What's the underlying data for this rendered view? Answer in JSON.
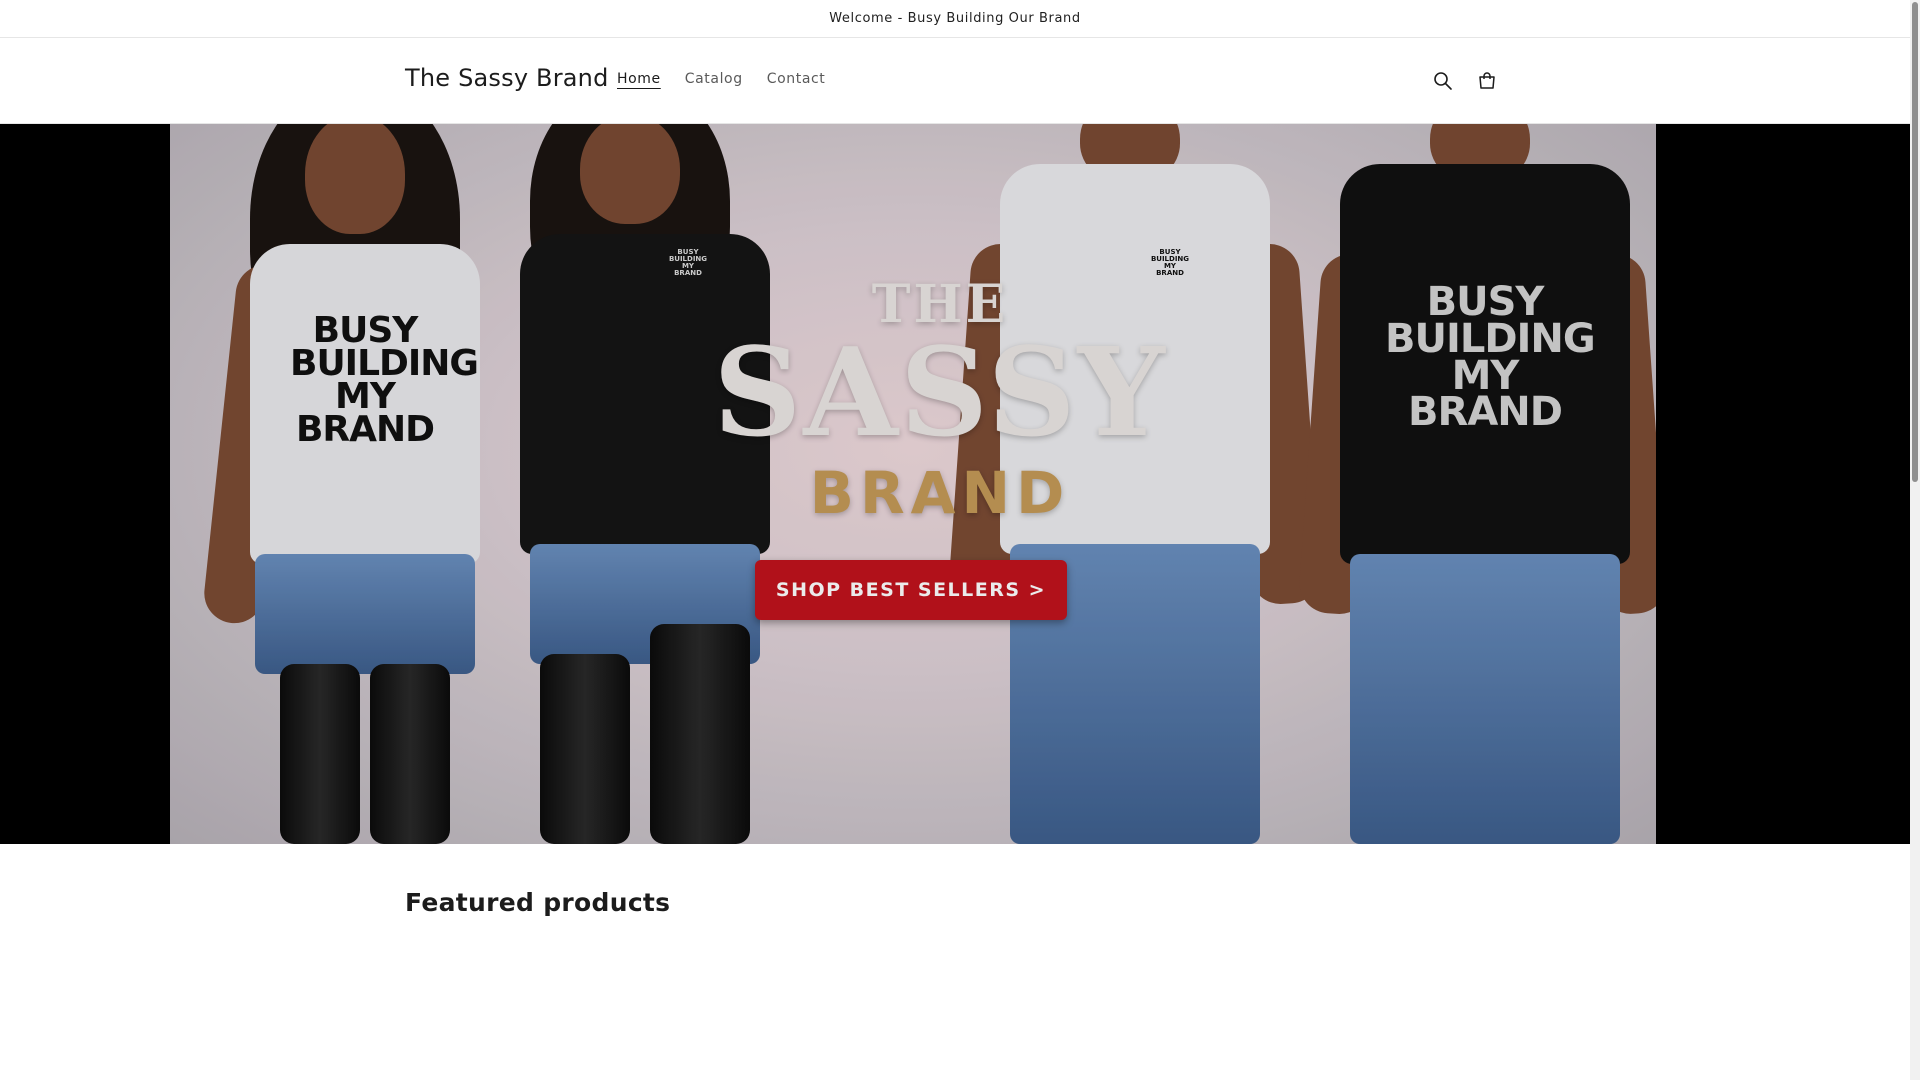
{
  "announcement": {
    "text": "Welcome - Busy Building Our Brand"
  },
  "header": {
    "brand": "The Sassy Brand",
    "nav": [
      {
        "label": "Home",
        "active": true
      },
      {
        "label": "Catalog",
        "active": false
      },
      {
        "label": "Contact",
        "active": false
      }
    ],
    "icons": {
      "search": "search-icon",
      "cart": "cart-icon"
    }
  },
  "hero": {
    "title_line1": "THE",
    "title_line2": "SASSY",
    "title_line3": "BRAND",
    "cta_label": "SHOP BEST SELLERS >",
    "shirt_text": "BUSY BUILDING MY BRAND",
    "mini_logo": "BUSY BUILDING MY BRAND",
    "colors": {
      "cta": "#c1131d",
      "gold": "#c49a57",
      "side_bars": "#000000"
    }
  },
  "featured": {
    "title": "Featured products"
  }
}
